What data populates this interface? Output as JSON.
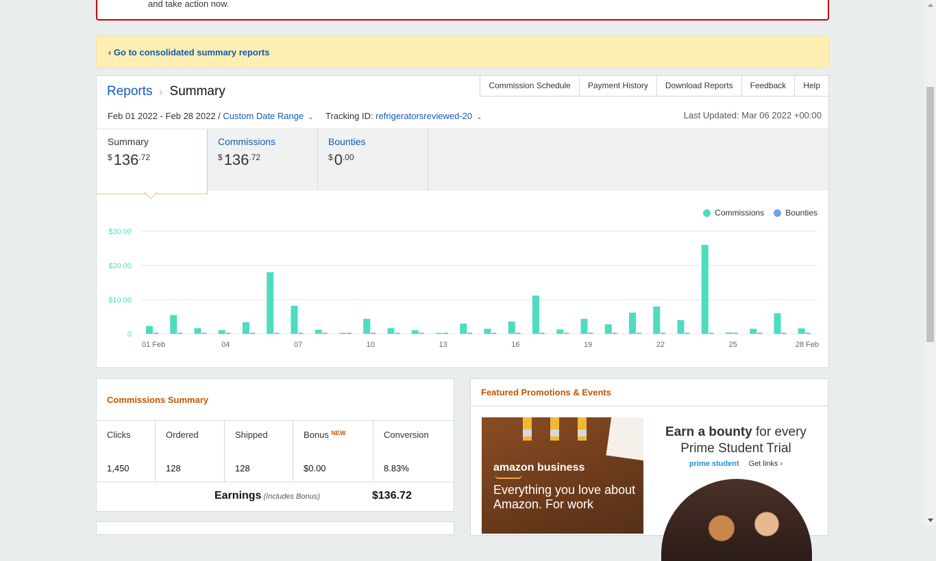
{
  "alert": {
    "text": "and take action now."
  },
  "notice": {
    "link": "‹ Go to consolidated summary reports"
  },
  "breadcrumb": {
    "parent": "Reports",
    "separator": "›",
    "current": "Summary"
  },
  "top_tabs": [
    "Commission Schedule",
    "Payment History",
    "Download Reports",
    "Feedback",
    "Help"
  ],
  "filters": {
    "date_range": "Feb 01 2022 - Feb 28 2022 /",
    "date_link": "Custom Date Range",
    "tracking_label": "Tracking ID:",
    "tracking_value": "refrigeratorsreviewed-20",
    "chevron": "⌄"
  },
  "last_updated": "Last Updated: Mar 06 2022 +00:00",
  "metric_tabs": [
    {
      "label": "Summary",
      "currency": "$",
      "whole": "136",
      "decimal": ".72",
      "active": true
    },
    {
      "label": "Commissions",
      "currency": "$",
      "whole": "136",
      "decimal": ".72",
      "active": false
    },
    {
      "label": "Bounties",
      "currency": "$",
      "whole": "0",
      "decimal": ".00",
      "active": false
    }
  ],
  "colors": {
    "commissions": "#4ddcc0",
    "bounties": "#6aa4e8",
    "accent": "#c45500",
    "link": "#0f5ab8"
  },
  "chart_data": {
    "type": "bar",
    "categories": [
      "01 Feb",
      "02",
      "03",
      "04",
      "05",
      "06",
      "07",
      "08",
      "09",
      "10",
      "11",
      "12",
      "13",
      "14",
      "15",
      "16",
      "17",
      "18",
      "19",
      "20",
      "21",
      "22",
      "23",
      "24",
      "25",
      "26",
      "27",
      "28 Feb"
    ],
    "tick_labels": [
      "01 Feb",
      "",
      "",
      "04",
      "",
      "",
      "07",
      "",
      "",
      "10",
      "",
      "",
      "13",
      "",
      "",
      "16",
      "",
      "",
      "19",
      "",
      "",
      "22",
      "",
      "",
      "25",
      "",
      "",
      "28 Feb"
    ],
    "series": [
      {
        "name": "Commissions",
        "values": [
          2.3,
          5.5,
          1.7,
          1.1,
          3.4,
          18.0,
          8.2,
          1.2,
          0.3,
          4.4,
          1.7,
          1.1,
          0.3,
          3.0,
          1.5,
          3.6,
          11.2,
          1.3,
          4.4,
          2.8,
          6.2,
          8.0,
          4.0,
          26.0,
          0.4,
          1.5,
          6.0,
          1.6
        ]
      },
      {
        "name": "Bounties",
        "values": [
          0.3,
          0.3,
          0.3,
          0.3,
          0.3,
          0.3,
          0.3,
          0.3,
          0.3,
          0.3,
          0.3,
          0.3,
          0.3,
          0.3,
          0.3,
          0.3,
          0.3,
          0.3,
          0.3,
          0.3,
          0.3,
          0.3,
          0.3,
          0.3,
          0.3,
          0.3,
          0.3,
          0.3
        ]
      }
    ],
    "y_ticks": [
      "0",
      "$10.00",
      "$20.00",
      "$30.00"
    ],
    "y_tick_values": [
      0,
      10,
      20,
      30
    ],
    "ylim": [
      0,
      30
    ],
    "legend_position": "top-right",
    "grid": true
  },
  "commissions_summary": {
    "title": "Commissions Summary",
    "stats": [
      {
        "label": "Clicks",
        "value": "1,450"
      },
      {
        "label": "Ordered",
        "value": "128"
      },
      {
        "label": "Shipped",
        "value": "128"
      },
      {
        "label": "Bonus",
        "badge": "NEW",
        "value": "$0.00"
      },
      {
        "label": "Conversion",
        "value": "8.83%"
      }
    ],
    "earnings_label": "Earnings",
    "earnings_note": "(Includes Bonus)",
    "earnings_value": "$136.72"
  },
  "promotions": {
    "title": "Featured Promotions & Events",
    "business": {
      "logo": "amazon business",
      "text": "Everything you love about Amazon. For work"
    },
    "student": {
      "title_bold": "Earn a bounty",
      "title_rest": "for every Prime Student Trial",
      "brand": "prime student",
      "links": "Get links ›"
    }
  }
}
